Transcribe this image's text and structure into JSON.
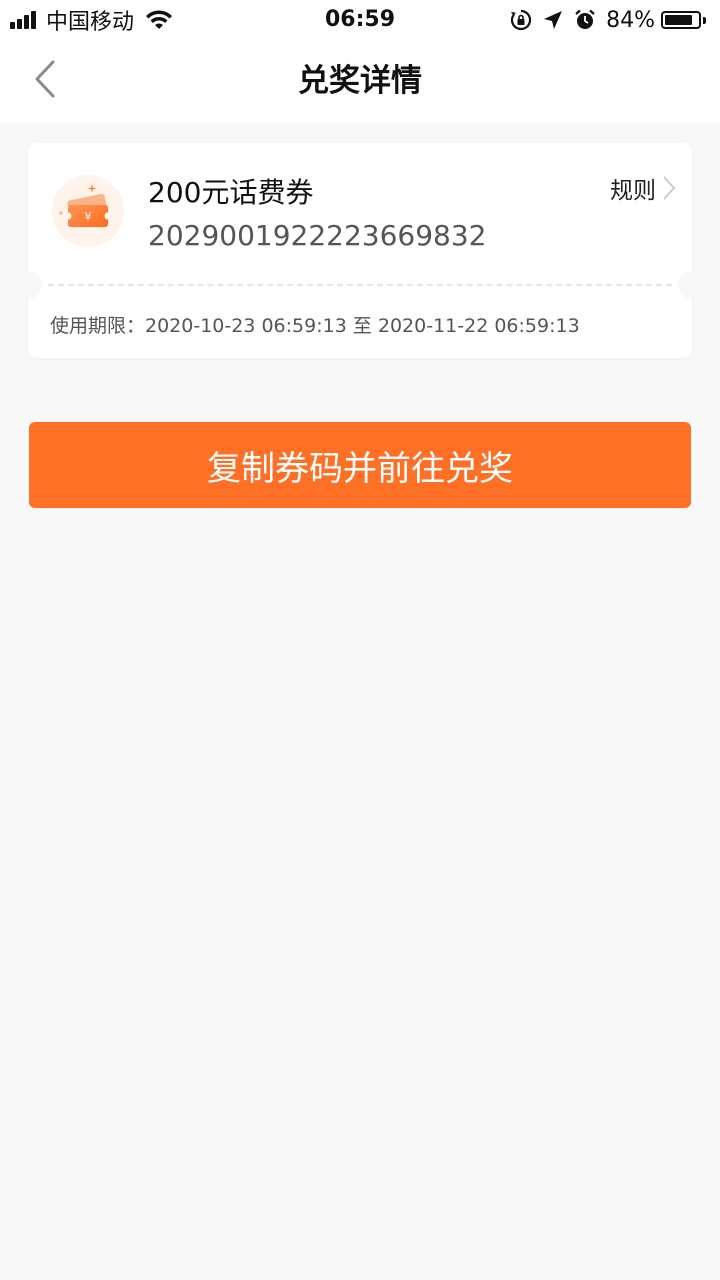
{
  "status_bar": {
    "carrier": "中国移动",
    "time": "06:59",
    "battery_percent": "84%",
    "battery_level": 0.84,
    "icons": [
      "signal-icon",
      "wifi-icon",
      "rotation-lock-icon",
      "location-icon",
      "alarm-icon",
      "battery-icon"
    ]
  },
  "nav": {
    "title": "兑奖详情",
    "back_icon": "chevron-left-icon"
  },
  "coupon": {
    "name": "200元话费券",
    "code": "2029001922223669832",
    "rules_label": "规则",
    "validity_text": "使用期限：2020-10-23 06:59:13 至 2020-11-22 06:59:13",
    "icon": "coupon-ticket-icon"
  },
  "action": {
    "label": "复制券码并前往兑奖"
  },
  "colors": {
    "accent": "#fd7026",
    "background": "#f8f8f8",
    "card": "#ffffff",
    "icon_bg": "#fff3ec"
  }
}
